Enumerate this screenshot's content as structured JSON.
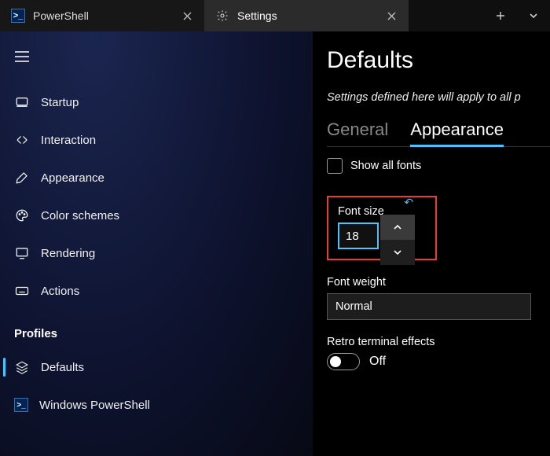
{
  "tabs": {
    "powershell": "PowerShell",
    "settings": "Settings"
  },
  "sidebar": {
    "items": [
      {
        "label": "Startup"
      },
      {
        "label": "Interaction"
      },
      {
        "label": "Appearance"
      },
      {
        "label": "Color schemes"
      },
      {
        "label": "Rendering"
      },
      {
        "label": "Actions"
      }
    ],
    "profiles_header": "Profiles",
    "profiles": [
      {
        "label": "Defaults"
      },
      {
        "label": "Windows PowerShell"
      }
    ]
  },
  "content": {
    "title": "Defaults",
    "description": "Settings defined here will apply to all p",
    "subtabs": {
      "general": "General",
      "appearance": "Appearance"
    },
    "show_all_fonts": "Show all fonts",
    "font_size_label": "Font size",
    "font_size_value": "18",
    "font_weight_label": "Font weight",
    "font_weight_value": "Normal",
    "retro_label": "Retro terminal effects",
    "retro_state": "Off"
  }
}
